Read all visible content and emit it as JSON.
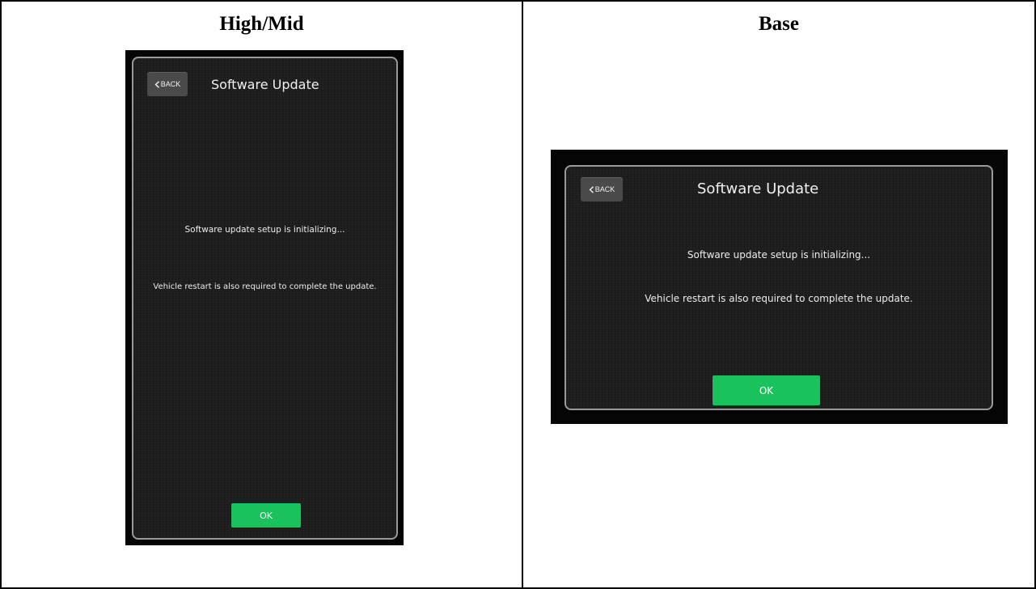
{
  "table": {
    "headers": [
      "High/Mid",
      "Base"
    ]
  },
  "screens": {
    "high_mid": {
      "back_label": "BACK",
      "title": "Software Update",
      "message_1": "Software update setup is initializing...",
      "message_2": "Vehicle restart is also required to complete the update.",
      "ok_label": "OK"
    },
    "base": {
      "back_label": "BACK",
      "title": "Software Update",
      "message_1": "Software update setup is initializing...",
      "message_2": "Vehicle restart is also required to complete the update.",
      "ok_label": "OK"
    }
  },
  "colors": {
    "ok_button": "#19c25a",
    "screen_bg": "#1e1e1e",
    "back_button": "#4a4a4a"
  },
  "icons": {
    "back": "chevron-left-icon"
  }
}
